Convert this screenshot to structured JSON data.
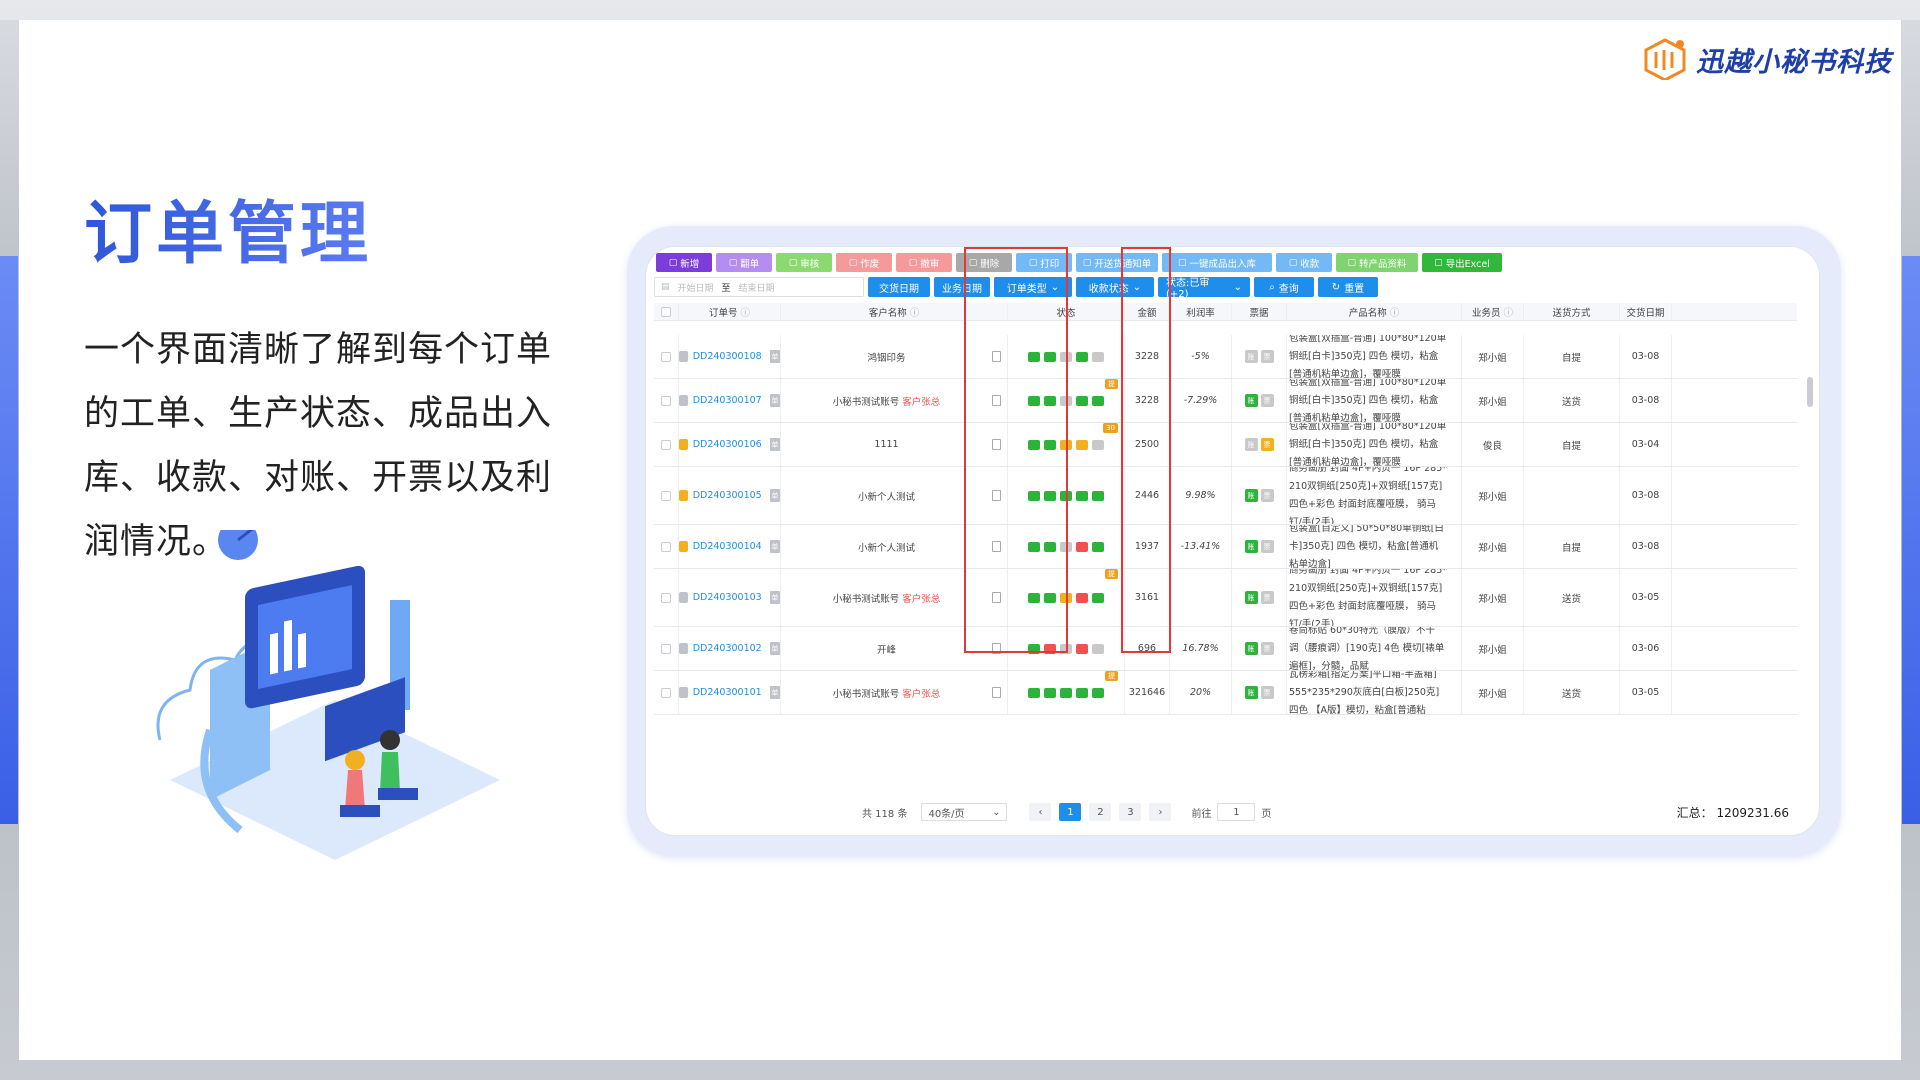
{
  "brand": {
    "name": "迅越小秘书科技"
  },
  "heading": "订单管理",
  "description": "一个界面清晰了解到每个订单的工单、生产状态、成品出入库、收款、对账、开票以及利润情况。",
  "toolbar": [
    {
      "label": "新增",
      "color": "#7c3ddb",
      "icon": "document-icon"
    },
    {
      "label": "翻单",
      "color": "#b58cf0",
      "icon": "copy-icon"
    },
    {
      "label": "审核",
      "color": "#8cd970",
      "icon": "user-icon"
    },
    {
      "label": "作废",
      "color": "#f59a9a",
      "icon": "ban-icon"
    },
    {
      "label": "撤审",
      "color": "#f59a9a",
      "icon": "undo-icon"
    },
    {
      "label": "删除",
      "color": "#a8a8a8",
      "icon": "trash-icon"
    },
    {
      "label": "打印",
      "color": "#72b9f5",
      "icon": "print-icon"
    },
    {
      "label": "开送货通知单",
      "color": "#72b9f5",
      "icon": "truck-icon"
    },
    {
      "label": "一键成品出入库",
      "color": "#72b9f5",
      "icon": "cart-icon"
    },
    {
      "label": "收款",
      "color": "#72b9f5",
      "icon": "wallet-icon"
    },
    {
      "label": "转产品资料",
      "color": "#7fd370",
      "icon": "refresh-icon"
    },
    {
      "label": "导出Excel",
      "color": "#2fb83a",
      "icon": "excel-icon"
    }
  ],
  "filters": {
    "start_placeholder": "开始日期",
    "separator": "至",
    "end_placeholder": "结束日期",
    "buttons": [
      "交货日期",
      "业务日期",
      "订单类型",
      "收款状态",
      "状态:已审(+2)",
      "查询",
      "重置"
    ]
  },
  "columns": [
    "订单号",
    "客户名称",
    "状态",
    "金额",
    "利润率",
    "票据",
    "产品名称",
    "业务员",
    "送货方式",
    "交货日期"
  ],
  "rows": [
    {
      "no": "DD240300108",
      "customer": "鸿铟印务",
      "tag": "",
      "badge": "",
      "amount": "3228",
      "profit": "-5%",
      "profit_type": "neg",
      "product": [
        "包装盒[双插盒-普通] 100*80*120单",
        "铜纸[白卡]350克] 四色 模切，粘盒",
        "[普通机粘单边盒]，覆哑膜"
      ],
      "sales": "郑小姐",
      "delivery": "自提",
      "date": "03-08",
      "status": [
        "#2db33a",
        "#2db33a",
        "#c9c9c9",
        "#2db33a",
        "#c9c9c9"
      ],
      "iv": [
        "#c9c9c9",
        "#c9c9c9"
      ]
    },
    {
      "no": "DD240300107",
      "customer": "小秘书测试账号",
      "tag": "客户张总",
      "badge": "提",
      "amount": "3228",
      "profit": "-7.29%",
      "profit_type": "neg",
      "product": [
        "包装盒[双插盒-普通] 100*80*120单",
        "铜纸[白卡]350克] 四色 模切，粘盒",
        "[普通机粘单边盒]，覆哑膜"
      ],
      "sales": "郑小姐",
      "delivery": "送货",
      "date": "03-08",
      "status": [
        "#2db33a",
        "#2db33a",
        "#c9c9c9",
        "#2db33a",
        "#2db33a"
      ],
      "iv": [
        "#2db33a",
        "#c9c9c9"
      ]
    },
    {
      "no": "DD240300106",
      "customer": "1111",
      "tag": "",
      "badge": "30",
      "amount": "2500",
      "profit": "",
      "profit_type": "",
      "product": [
        "包装盒[双插盒-普通] 100*80*120单",
        "铜纸[白卡]350克] 四色 模切，粘盒",
        "[普通机粘单边盒]，覆哑膜"
      ],
      "sales": "俊良",
      "delivery": "自提",
      "date": "03-04",
      "status": [
        "#2db33a",
        "#2db33a",
        "#f0b020",
        "#f0b020",
        "#c9c9c9"
      ],
      "iv": [
        "#c9c9c9",
        "#f0b020"
      ]
    },
    {
      "no": "DD240300105",
      "customer": "小新个人测试",
      "tag": "",
      "badge": "",
      "amount": "2446",
      "profit": "9.98%",
      "profit_type": "pos",
      "product": [
        "商务画册 封面 4P+内页一 16P 285*",
        "210双铜纸[250克]+双铜纸[157克]",
        "四色+彩色 封面封底覆哑膜， 骑马",
        "钉/手(2手)"
      ],
      "sales": "郑小姐",
      "delivery": "",
      "date": "03-08",
      "status": [
        "#2db33a",
        "#2db33a",
        "#2db33a",
        "#2db33a",
        "#2db33a"
      ],
      "iv": [
        "#2db33a",
        "#c9c9c9"
      ]
    },
    {
      "no": "DD240300104",
      "customer": "小新个人测试",
      "tag": "",
      "badge": "",
      "amount": "1937",
      "profit": "-13.41%",
      "profit_type": "neg",
      "product": [
        "包装盒[自定义] 50*50*80单铜纸[白",
        "卡]350克] 四色 模切，粘盒[普通机",
        "粘单边盒]"
      ],
      "sales": "郑小姐",
      "delivery": "自提",
      "date": "03-08",
      "status": [
        "#2db33a",
        "#2db33a",
        "#c9c9c9",
        "#f05050",
        "#2db33a"
      ],
      "iv": [
        "#2db33a",
        "#c9c9c9"
      ]
    },
    {
      "no": "DD240300103",
      "customer": "小秘书测试账号",
      "tag": "客户张总",
      "badge": "提",
      "amount": "3161",
      "profit": "",
      "profit_type": "",
      "product": [
        "商务画册 封面 4P+内页一 16P 285*",
        "210双铜纸[250克]+双铜纸[157克]",
        "四色+彩色 封面封底覆哑膜， 骑马",
        "钉/手(2手)"
      ],
      "sales": "郑小姐",
      "delivery": "送货",
      "date": "03-05",
      "status": [
        "#2db33a",
        "#2db33a",
        "#f0b020",
        "#f05050",
        "#2db33a"
      ],
      "iv": [
        "#2db33a",
        "#c9c9c9"
      ]
    },
    {
      "no": "DD240300102",
      "customer": "开峰",
      "tag": "",
      "badge": "",
      "amount": "696",
      "profit": "16.78%",
      "profit_type": "pos",
      "product": [
        "卷筒标贴 60*30特光（膜版）不干",
        "调（腰痕调）[190克] 4色 模切[裱单",
        "遍框]，分髓，品赋"
      ],
      "sales": "郑小姐",
      "delivery": "",
      "date": "03-06",
      "status": [
        "#2db33a",
        "#f05050",
        "#c9c9c9",
        "#f05050",
        "#c9c9c9"
      ],
      "iv": [
        "#2db33a",
        "#c9c9c9"
      ]
    },
    {
      "no": "DD240300101",
      "customer": "小秘书测试账号",
      "tag": "客户张总",
      "badge": "提",
      "amount": "321646",
      "profit": "20%",
      "profit_type": "pos",
      "product": [
        "瓦楞彩箱[指定方案]平口箱-半盖箱]",
        "555*235*290灰底白[白板]250克]",
        "四色 【A版】模切，粘盒[普通粘"
      ],
      "sales": "郑小姐",
      "delivery": "送货",
      "date": "03-05",
      "status": [
        "#2db33a",
        "#2db33a",
        "#2db33a",
        "#2db33a",
        "#2db33a"
      ],
      "iv": [
        "#2db33a",
        "#c9c9c9"
      ]
    }
  ],
  "pager": {
    "total": "共 118 条",
    "page_size": "40条/页",
    "pages": [
      "1",
      "2",
      "3"
    ],
    "current": "1",
    "goto_label": "前往",
    "goto_value": "1",
    "page_suffix": "页",
    "summary": "汇总：  1209231.66"
  }
}
